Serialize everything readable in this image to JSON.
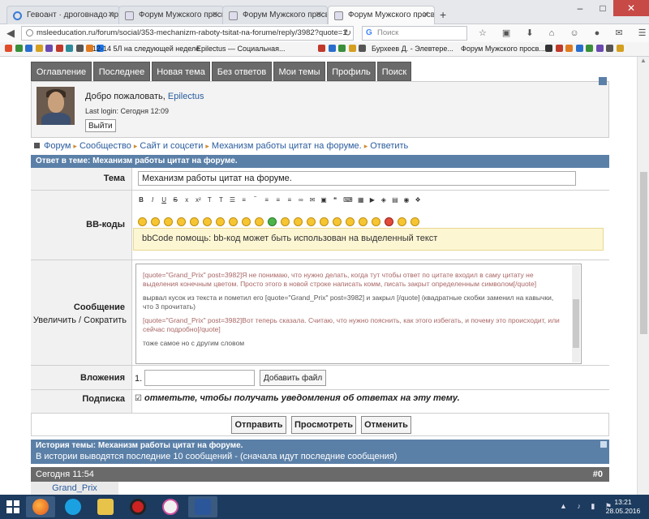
{
  "browser": {
    "tabs": [
      {
        "title": "Гевоант · дроговнадо пр...",
        "active": false
      },
      {
        "title": "Форум Мужского просв...",
        "active": false
      },
      {
        "title": "Форум Мужского просв...",
        "active": false
      },
      {
        "title": "Форум Мужского просв...",
        "active": true
      }
    ],
    "url": "msleeducation.ru/forum/social/353-mechanizm-raboty-tsitat-na-forume/reply/3982?quote=1",
    "search_placeholder": "Поиск",
    "bookmarks": [
      "12-14 5Л на следующей неделе",
      "Epilectus — Социальная...",
      "Бурхеев Д. - Элевтере...",
      "Форум Мужского просв..."
    ]
  },
  "forum": {
    "nav_tabs": [
      "Оглавление",
      "Последнее",
      "Новая тема",
      "Без ответов",
      "Мои темы",
      "Профиль",
      "Поиск"
    ],
    "welcome_text": "Добро пожаловать,",
    "username": "Epilectus",
    "last_login": "Last login: Сегодня 12:09",
    "exit_label": "Выйти",
    "breadcrumb": [
      "Форум",
      "Сообщество",
      "Сайт и соцсети",
      "Механизм работы цитат на форуме.",
      "Ответить"
    ],
    "reply_header": "Ответ в теме: Механизм работы цитат на форуме.",
    "labels": {
      "topic": "Тема",
      "bbcodes": "BB-коды",
      "message": "Сообщение",
      "enlarge": "Увеличить",
      "divider": "/",
      "shrink": "Сократить",
      "attachments": "Вложения",
      "subscription": "Подписка"
    },
    "topic_value": "Механизм работы цитат на форуме.",
    "bb_help": "bbCode помощь: bb-код может быть использован на выделенный текст",
    "message_lines": [
      "[quote=\"Grand_Prix\" post=3982]Я не понимаю, что нужно делать, когда тут чтобы ответ по цитате входил в саму цитату не выделения конечным цветом. Просто этого в новой строке написать комм, писать закрыт определенным символом[/quote]",
      "вырвал кусок из текста и пометил его [quote=\"Grand_Prix\" post=3982] и закрыл [/quote] (квадратные скобки заменил на кавычки, что 3 прочитать)",
      "[quote=\"Grand_Prix\" post=3982]Вот теперь сказала. Считаю, что нужно пояснить, как этого избегать, и почему это происходит, или сейчас подробно[/quote]",
      "тоже самое но с другим словом"
    ],
    "attach_index": "1.",
    "attach_button": "Добавить файл",
    "subscribe_text": "отметьте, чтобы получать уведомления об ответах на эту тему.",
    "buttons": {
      "submit": "Отправить",
      "preview": "Просмотреть",
      "cancel": "Отменить"
    },
    "history_title": "История темы: Механизм работы цитат на форуме.",
    "history_note": "В истории выводятся последние 10 сообщений - (сначала идут последние сообщения)",
    "post_time": "Сегодня 11:54",
    "post_number": "#0",
    "post_author": "Grand_Prix"
  },
  "taskbar": {
    "time": "13:21",
    "date": "28.05.2016"
  },
  "colors": {
    "accent": "#5b80a8",
    "tab_gray": "#6a6a6a",
    "link": "#2a5c9e"
  }
}
